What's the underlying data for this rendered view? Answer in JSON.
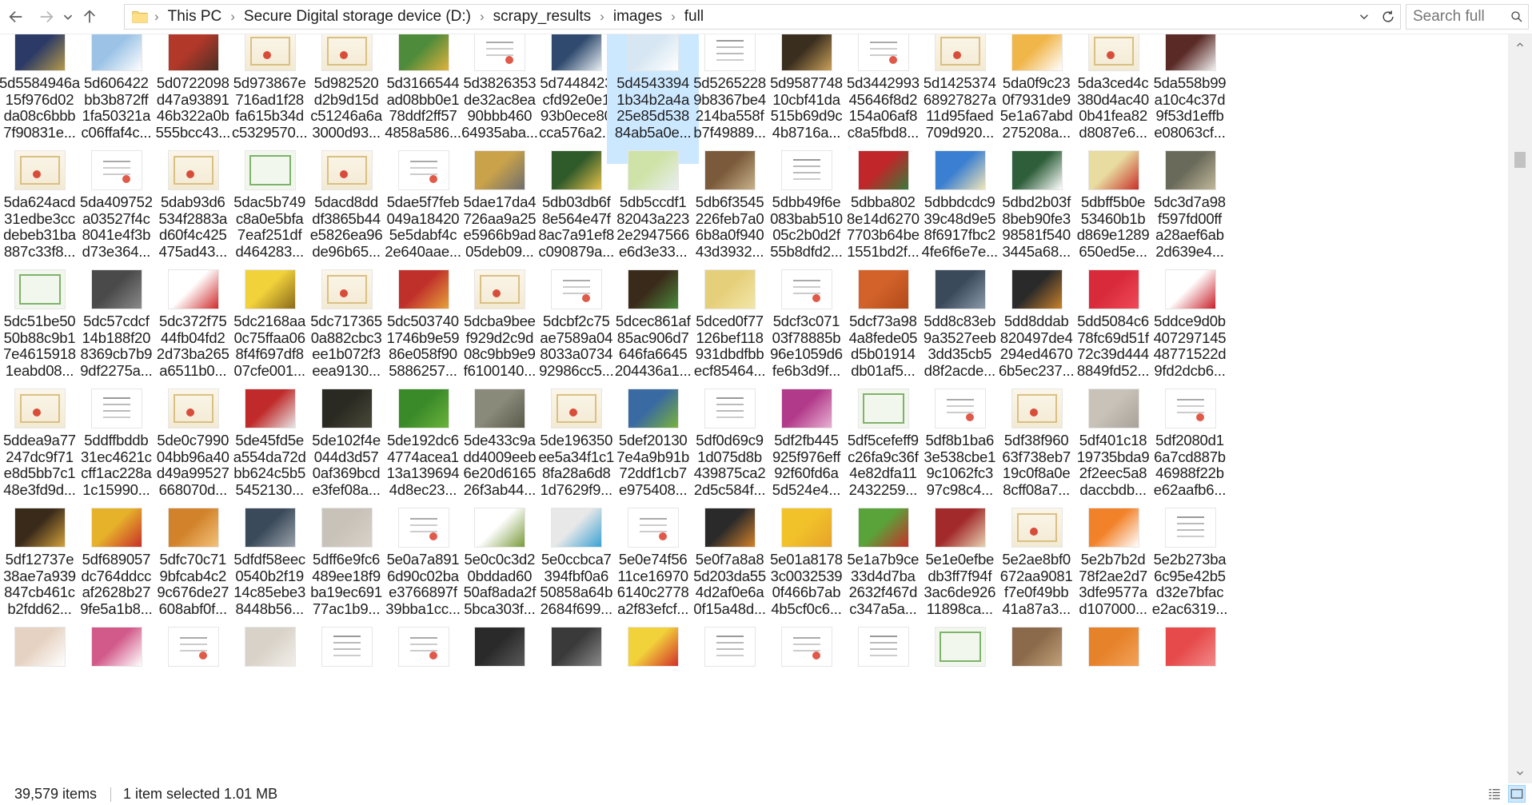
{
  "window": {
    "title": "full"
  },
  "nav": {
    "back": "back",
    "forward": "forward",
    "recent": "recent-locations",
    "up": "up"
  },
  "address": {
    "crumbs": [
      "This PC",
      "Secure Digital storage device (D:)",
      "scrapy_results",
      "images",
      "full"
    ]
  },
  "search": {
    "placeholder": "Search full"
  },
  "status": {
    "items": "39,579 items",
    "selected": "1 item selected  1.01 MB"
  },
  "files": [
    {
      "name": "5d5584946a\n15f976d02\nda08c6bbb\n7f90831e...",
      "thumb": "photo",
      "colors": [
        "#2b3a66",
        "#b59a4a"
      ]
    },
    {
      "name": "5d606422\nbb3b872ff\n1fa50321a\nc06ffaf4c...",
      "thumb": "photo",
      "colors": [
        "#9cc3e6",
        "#ffffff"
      ]
    },
    {
      "name": "5d0722098\nd47a93891\n46b322a0b\n555bcc43...",
      "thumb": "photo",
      "colors": [
        "#b2382a",
        "#4a3024"
      ]
    },
    {
      "name": "5d973867e\n716ad1f28\nfa615b34d\nc5329570...",
      "thumb": "cert",
      "colors": []
    },
    {
      "name": "5d982520\nd2b9d15d\nc51246a6a\n3000d93...",
      "thumb": "cert",
      "colors": []
    },
    {
      "name": "5d3166544\nad08bb0e1\n78ddf2ff57\n4858a586...",
      "thumb": "photo",
      "colors": [
        "#4e8b3a",
        "#e0b23c"
      ]
    },
    {
      "name": "5d3826353\nde32ac8ea\n90bbb460\n64935aba...",
      "thumb": "docs",
      "colors": []
    },
    {
      "name": "5d7448423\ncfd92e0e1\n93b0ece80\ncca576a2...",
      "thumb": "photo",
      "colors": [
        "#2f4a6e",
        "#e8eef4"
      ]
    },
    {
      "name": "5d4543394\n1b34b2a4a\n25e85d538\n84ab5a0e...",
      "thumb": "photo",
      "colors": [
        "#d6e6f2",
        "#ffffff"
      ]
    },
    {
      "name": "5d5265228\n9b8367be4\n214ba558f\nb7f49889...",
      "thumb": "doc",
      "colors": []
    },
    {
      "name": "5d9587748\n10cbf41da\n515b69d9c\n4b8716a...",
      "thumb": "photo",
      "colors": [
        "#3a2e1e",
        "#c9a15a"
      ]
    },
    {
      "name": "5d3442993\n45646f8d2\n154a06af8\nc8a5fbd8...",
      "thumb": "docs",
      "colors": []
    },
    {
      "name": "5d1425374\n68927827a\n11d95faed\n709d920...",
      "thumb": "cert",
      "colors": []
    },
    {
      "name": "5da0f9c23\n0f7931de9\n5e1a67abd\n275208a...",
      "thumb": "photo",
      "colors": [
        "#f0b64a",
        "#ffffff"
      ]
    },
    {
      "name": "5da3ced4c\n380d4ac40\n0b41fea82\nd8087e6...",
      "thumb": "cert",
      "colors": []
    },
    {
      "name": "5da558b99\na10c4c37d\n9f53d1effb\ne08063cf...",
      "thumb": "photo",
      "colors": [
        "#5a2a26",
        "#f2f2f2"
      ]
    },
    {
      "name": "5da624acd\n31edbe3cc\ndebeb31ba\n887c33f8...",
      "thumb": "cert",
      "colors": []
    },
    {
      "name": "5da409752\na03527f4c\n8041e4f3b\nd73e364...",
      "thumb": "docs",
      "colors": []
    },
    {
      "name": "5dab93d6\n534f2883a\nd60f4c425\n475ad43...",
      "thumb": "cert",
      "colors": []
    },
    {
      "name": "5dac5b749\nc8a0e5bfa\n7eaf251df\nd464283...",
      "thumb": "certg",
      "colors": []
    },
    {
      "name": "5dacd8dd\ndf3865b44\ne5826ea96\nde96b65...",
      "thumb": "cert",
      "colors": []
    },
    {
      "name": "5dae5f7feb\n049a18420\n5e5dabf4c\n2e640aae...",
      "thumb": "docs",
      "colors": []
    },
    {
      "name": "5dae17da4\n726aa9a25\ne5966b9ad\n05deb09...",
      "thumb": "photo",
      "colors": [
        "#c9a24a",
        "#6e6e6e"
      ]
    },
    {
      "name": "5db03db6f\n8e564e47f\n8ac7a91ef8\nc090879a...",
      "thumb": "photo",
      "colors": [
        "#2f5a2a",
        "#e6c24a"
      ]
    },
    {
      "name": "5db5ccdf1\n82043a223\n2e2947566\ne6d3e33...",
      "thumb": "photo",
      "colors": [
        "#cfe3a8",
        "#e9eef0"
      ]
    },
    {
      "name": "5db6f3545\n226feb7a0\n6b8a0f940\n43d3932...",
      "thumb": "photo",
      "colors": [
        "#7a5a3a",
        "#c8b28a"
      ]
    },
    {
      "name": "5dbb49f6e\n083bab510\n05c2b0d2f\n55b8dfd2...",
      "thumb": "doc",
      "colors": []
    },
    {
      "name": "5dbba802\n8e14d6270\n7703b64be\n1551bd2f...",
      "thumb": "photo",
      "colors": [
        "#c0262a",
        "#3a7a3a"
      ]
    },
    {
      "name": "5dbbdcdc9\n39c48d9e5\n8f6917fbc2\n4fe6f6e7e...",
      "thumb": "photo",
      "colors": [
        "#3a7fd1",
        "#f2e6b8"
      ]
    },
    {
      "name": "5dbd2b03f\n8beb90fe3\n98581f540\n3445a68...",
      "thumb": "photo",
      "colors": [
        "#2e5e3a",
        "#ffffff"
      ]
    },
    {
      "name": "5dbff5b0e\n53460b1b\nd869e1289\n650ed5e...",
      "thumb": "photo",
      "colors": [
        "#e8dca0",
        "#c8302a"
      ]
    },
    {
      "name": "5dc3d7a98\nf597fd00ff\na28aef6ab\n2d639e4...",
      "thumb": "photo",
      "colors": [
        "#6a6a5a",
        "#c0b89a"
      ]
    },
    {
      "name": "5dc51be50\n50b88c9b1\n7e4615918\n1eabd08...",
      "thumb": "certg",
      "colors": []
    },
    {
      "name": "5dc57cdcf\n14b188f20\n8369cb7b9\n9df2275a...",
      "thumb": "photo",
      "colors": [
        "#4a4a4a",
        "#8a8a8a"
      ]
    },
    {
      "name": "5dc372f75\n44fb04fd2\n2d73ba265\na6511b0...",
      "thumb": "photo",
      "colors": [
        "#ffffff",
        "#d02a2a"
      ]
    },
    {
      "name": "5dc2168aa\n0c75ffaa06\n8f4f697df8\n07cfe001...",
      "thumb": "photo",
      "colors": [
        "#f2d23a",
        "#8a6a1a"
      ]
    },
    {
      "name": "5dc717365\n0a882cbc3\nee1b072f3\neea9130...",
      "thumb": "cert",
      "colors": []
    },
    {
      "name": "5dc503740\n1746b9e59\n86e058f90\n5886257...",
      "thumb": "photo",
      "colors": [
        "#c0302a",
        "#e6a23a"
      ]
    },
    {
      "name": "5dcba9bee\nf929d2c9d\n08c9bb9e9\nf6100140...",
      "thumb": "cert",
      "colors": []
    },
    {
      "name": "5dcbf2c75\nae7589a04\n8033a0734\n92986cc5...",
      "thumb": "docs",
      "colors": []
    },
    {
      "name": "5dcec861af\n85ac906d7\n646fa6645\n204436a1...",
      "thumb": "photo",
      "colors": [
        "#3a2a1a",
        "#4a8a3a"
      ]
    },
    {
      "name": "5dced0f77\n126bef118\n931dbdfbb\necf85464...",
      "thumb": "photo",
      "colors": [
        "#e6cf7a",
        "#f2e6a8"
      ]
    },
    {
      "name": "5dcf3c071\n03f78885b\n96e1059d6\nfe6b3d9f...",
      "thumb": "docs",
      "colors": []
    },
    {
      "name": "5dcf73a98\n4a8fede05\nd5b01914\ndb01af5...",
      "thumb": "photo",
      "colors": [
        "#d2622a",
        "#b24a1a"
      ]
    },
    {
      "name": "5dd8c83eb\n9a3527eeb\n3dd35cb5\nd8f2acde...",
      "thumb": "photo",
      "colors": [
        "#3a4a5a",
        "#8a9aaa"
      ]
    },
    {
      "name": "5dd8ddab\n820497de4\n294ed4670\n6b5ec237...",
      "thumb": "photo",
      "colors": [
        "#2a2a2a",
        "#c8822a"
      ]
    },
    {
      "name": "5dd5084c6\n78fc69d51f\n72c39d444\n8849fd52...",
      "thumb": "photo",
      "colors": [
        "#d82a3a",
        "#f04a5a"
      ]
    },
    {
      "name": "5ddce9d0b\n407297145\n48771522d\n9fd2dcb6...",
      "thumb": "photo",
      "colors": [
        "#ffffff",
        "#c8202a"
      ]
    },
    {
      "name": "5ddea9a77\n247dc9f71\ne8d5bb7c1\n48e3fd9d...",
      "thumb": "cert",
      "colors": []
    },
    {
      "name": "5ddffbddb\n31ec4621c\ncff1ac228a\n1c15990...",
      "thumb": "doc",
      "colors": []
    },
    {
      "name": "5de0c7990\n04bb96a40\nd49a99527\n668070d...",
      "thumb": "cert",
      "colors": []
    },
    {
      "name": "5de45fd5e\na554da72d\nbb624c5b5\n5452130...",
      "thumb": "photo",
      "colors": [
        "#c02a2a",
        "#e6e6e6"
      ]
    },
    {
      "name": "5de102f4e\n044d3d57\n0af369bcd\ne3fef08a...",
      "thumb": "photo",
      "colors": [
        "#2a2a22",
        "#4a4a3a"
      ]
    },
    {
      "name": "5de192dc6\n4774acea1\n13a139694\n4d8ec23...",
      "thumb": "photo",
      "colors": [
        "#3a8a2a",
        "#6ab23a"
      ]
    },
    {
      "name": "5de433c9a\ndd4009eeb\n6e20d6165\n26f3ab44...",
      "thumb": "photo",
      "colors": [
        "#8a8a7a",
        "#5a5a4a"
      ]
    },
    {
      "name": "5de196350\nee5a34f1c1\n8fa28a6d8\n1d7629f9...",
      "thumb": "cert",
      "colors": []
    },
    {
      "name": "5def20130\n7e4a9b91b\n72ddf1cb7\ne975408...",
      "thumb": "photo",
      "colors": [
        "#3a6aa2",
        "#7ab23a"
      ]
    },
    {
      "name": "5df0d69c9\n1d075d8b\n439875ca2\n2d5c584f...",
      "thumb": "doc",
      "colors": []
    },
    {
      "name": "5df2fb445\n925f976eff\n92f60fd6a\n5d524e4...",
      "thumb": "photo",
      "colors": [
        "#b23a8a",
        "#e6b2d2"
      ]
    },
    {
      "name": "5df5cefeff9\nc26fa9c36f\n4e82dfa11\n2432259...",
      "thumb": "certg",
      "colors": []
    },
    {
      "name": "5df8b1ba6\n3e538cbe1\n9c1062fc3\n97c98c4...",
      "thumb": "docs",
      "colors": []
    },
    {
      "name": "5df38f960\n63f738eb7\n19c0f8a0e\n8cff08a7...",
      "thumb": "cert",
      "colors": []
    },
    {
      "name": "5df401c18\n19735bda9\n2f2eec5a8\ndaccbdb...",
      "thumb": "photo",
      "colors": [
        "#c8c2b8",
        "#a8a298"
      ]
    },
    {
      "name": "5df2080d1\n6a7cd887b\n46988f22b\ne62aafb6...",
      "thumb": "docs",
      "colors": []
    },
    {
      "name": "5df12737e\n38ae7a939\n847cb461c\nb2fdd62...",
      "thumb": "photo",
      "colors": [
        "#3a2a1a",
        "#d2a23a"
      ]
    },
    {
      "name": "5df689057\ndc764ddcc\naf2628b27\n9fe5a1b8...",
      "thumb": "photo",
      "colors": [
        "#e6b22a",
        "#c8302a"
      ]
    },
    {
      "name": "5dfc70c71\n9bfcab4c2\n9c676de27\n608abf0f...",
      "thumb": "photo",
      "colors": [
        "#d2822a",
        "#f2c27a"
      ]
    },
    {
      "name": "5dfdf58eec\n0540b2f19\n14c85ebe3\n8448b56...",
      "thumb": "photo",
      "colors": [
        "#3a4a5a",
        "#9aa2aa"
      ]
    },
    {
      "name": "5dff6e9fc6\n489ee18f9\nba19ec691\n77ac1b9...",
      "thumb": "photo",
      "colors": [
        "#c8c2b8",
        "#d8d2c8"
      ]
    },
    {
      "name": "5e0a7a891\n6d90c02ba\ne3766897f\n39bba1cc...",
      "thumb": "docs",
      "colors": []
    },
    {
      "name": "5e0c0c3d2\n0bddad60\n50af8ada2f\n5bca303f...",
      "thumb": "photo",
      "colors": [
        "#ffffff",
        "#7a9a3a"
      ]
    },
    {
      "name": "5e0ccbca7\n394fbf0a6\n50858a64b\n2684f699...",
      "thumb": "photo",
      "colors": [
        "#e8e8e8",
        "#3aa2d2"
      ]
    },
    {
      "name": "5e0e74f56\n11ce16970\n6140c2778\na2f83efcf...",
      "thumb": "docs",
      "colors": []
    },
    {
      "name": "5e0f7a8a8\n5d203da55\n4d2af0e6a\n0f15a48d...",
      "thumb": "photo",
      "colors": [
        "#2a2a2a",
        "#d2822a"
      ]
    },
    {
      "name": "5e01a8178\n3c0032539\n0f466b7ab\n4b5cf0c6...",
      "thumb": "photo",
      "colors": [
        "#f2c22a",
        "#e6a22a"
      ]
    },
    {
      "name": "5e1a7b9ce\n33d4d7ba\n2632f467d\nc347a5a...",
      "thumb": "photo",
      "colors": [
        "#5aa23a",
        "#c8302a"
      ]
    },
    {
      "name": "5e1e0efbe\ndb3ff7f94f\n3ac6de926\n11898ca...",
      "thumb": "photo",
      "colors": [
        "#a22a2a",
        "#e6d2b2"
      ]
    },
    {
      "name": "5e2ae8bf0\n672aa9081\nf7e0f49bb\n41a87a3...",
      "thumb": "cert",
      "colors": []
    },
    {
      "name": "5e2b7b2d\n78f2ae2d7\n3dfe9577a\nd107000...",
      "thumb": "photo",
      "colors": [
        "#f2822a",
        "#ffffff"
      ]
    },
    {
      "name": "5e2b273ba\n6c95e42b5\nd32e7bfac\ne2ac6319...",
      "thumb": "doc",
      "colors": []
    },
    {
      "name": "",
      "thumb": "photo",
      "colors": [
        "#e6d2c2",
        "#ffffff"
      ]
    },
    {
      "name": "",
      "thumb": "photo",
      "colors": [
        "#d25a8a",
        "#ffffff"
      ]
    },
    {
      "name": "",
      "thumb": "docs",
      "colors": []
    },
    {
      "name": "",
      "thumb": "photo",
      "colors": [
        "#d8d2c8",
        "#f2eee8"
      ]
    },
    {
      "name": "",
      "thumb": "doc",
      "colors": []
    },
    {
      "name": "",
      "thumb": "docs",
      "colors": []
    },
    {
      "name": "",
      "thumb": "photo",
      "colors": [
        "#2a2a2a",
        "#5a5a5a"
      ]
    },
    {
      "name": "",
      "thumb": "photo",
      "colors": [
        "#3a3a3a",
        "#8a8a8a"
      ]
    },
    {
      "name": "",
      "thumb": "photo",
      "colors": [
        "#f2d23a",
        "#d2302a"
      ]
    },
    {
      "name": "",
      "thumb": "doc",
      "colors": []
    },
    {
      "name": "",
      "thumb": "docs",
      "colors": []
    },
    {
      "name": "",
      "thumb": "doc",
      "colors": []
    },
    {
      "name": "",
      "thumb": "certg",
      "colors": []
    },
    {
      "name": "",
      "thumb": "photo",
      "colors": [
        "#8a6a4a",
        "#c2a27a"
      ]
    },
    {
      "name": "",
      "thumb": "photo",
      "colors": [
        "#e6822a",
        "#f2a25a"
      ]
    },
    {
      "name": "",
      "thumb": "photo",
      "colors": [
        "#e64a4a",
        "#f28a8a"
      ]
    }
  ],
  "selected_index": 8,
  "theme": {
    "selection": "#cce8ff",
    "accent": "#0078d7"
  }
}
